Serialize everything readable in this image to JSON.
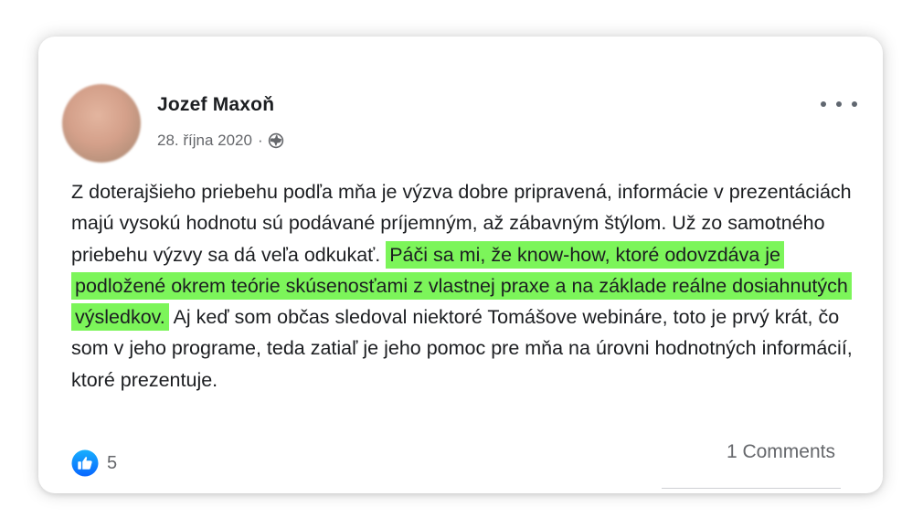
{
  "post": {
    "author": "Jozef Maxoň",
    "date": "28. října 2020",
    "separator": "·",
    "text_before": "Z doterajšieho priebehu podľa mňa je výzva dobre pripravená, informácie v prezentáciách majú vysokú hodnotu sú podávané príjemným, až zábavným štýlom. Už zo samotného priebehu výzvy sa dá veľa odkukať.",
    "text_highlighted": "Páči sa mi, že know-how, ktoré odovzdáva je podložené okrem teórie skúsenosťami z vlastnej praxe a na základe reálne dosiahnutých výsledkov.",
    "text_after": "Aj keď som občas sledoval niektoré Tomášove webináre, toto je prvý krát, čo som v jeho programe, teda zatiaľ je jeho pomoc pre mňa na úrovni hodnotných informácií, ktoré prezentuje.",
    "highlight_color": "#7cf55a"
  },
  "footer": {
    "like_count": "5",
    "comments_label": "1 Comments"
  },
  "icons": {
    "globe": "globe-icon",
    "more": "more-options-icon",
    "like": "like-icon"
  },
  "colors": {
    "like_blue": "#1877f2",
    "text": "#1c1e21",
    "secondary_text": "#65676b"
  }
}
